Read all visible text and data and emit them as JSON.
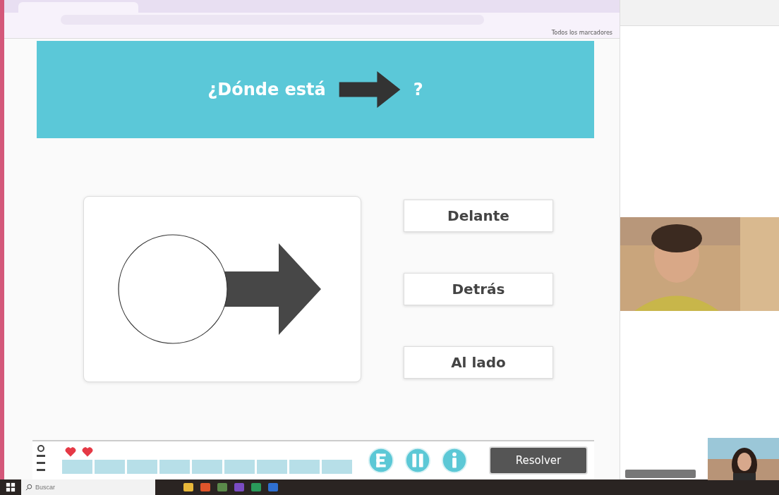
{
  "browser": {
    "bookmarks_all": "Todos los marcadores"
  },
  "quiz": {
    "question_before": "¿Dónde está",
    "question_after": "?",
    "answers": [
      {
        "label": "Delante",
        "selected": false
      },
      {
        "label": "Detrás",
        "selected": false
      },
      {
        "label": "Al lado",
        "selected": false
      }
    ],
    "hearts": [
      {
        "filled": true
      },
      {
        "filled": true
      }
    ],
    "progress": [
      {
        "done": false
      },
      {
        "done": false
      },
      {
        "done": false
      },
      {
        "done": false
      },
      {
        "done": false
      },
      {
        "done": false
      },
      {
        "done": false
      },
      {
        "done": false
      },
      {
        "done": false
      }
    ],
    "round_buttons": [
      {
        "kind": "e"
      },
      {
        "kind": "pause"
      },
      {
        "kind": "info"
      }
    ],
    "solve_button": "Resolver"
  },
  "taskbar": {
    "search_placeholder": "Buscar"
  }
}
